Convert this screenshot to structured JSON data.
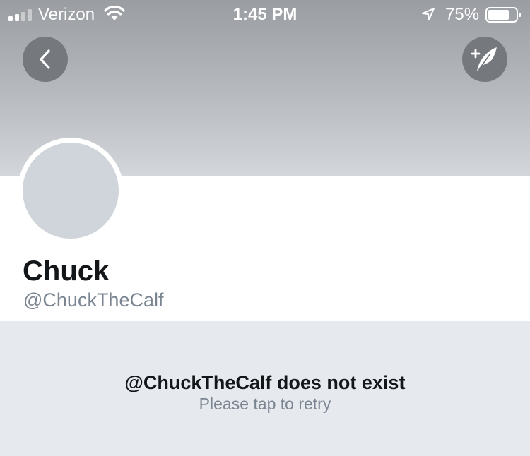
{
  "status_bar": {
    "carrier": "Verizon",
    "time": "1:45 PM",
    "battery_percent": "75%",
    "battery_level": 0.75,
    "signal_bars_filled": 2,
    "signal_bars_total": 4,
    "icons": [
      "signal-icon",
      "wifi-icon",
      "location-arrow-icon",
      "battery-icon"
    ]
  },
  "toolbar": {
    "back_icon": "chevron-left-icon",
    "compose_icon": "compose-tweet-icon"
  },
  "profile": {
    "name": "Chuck",
    "handle": "@ChuckTheCalf"
  },
  "error": {
    "title": "@ChuckTheCalf does not exist",
    "subtitle": "Please tap to retry"
  },
  "colors": {
    "header_top": "#9a9da2",
    "header_bottom": "#d3d6da",
    "button_bg": "#75787d",
    "avatar_placeholder": "#cfd5db",
    "background": "#e6e9ed",
    "primary_text": "#14171a",
    "secondary_text": "#7b8591"
  }
}
